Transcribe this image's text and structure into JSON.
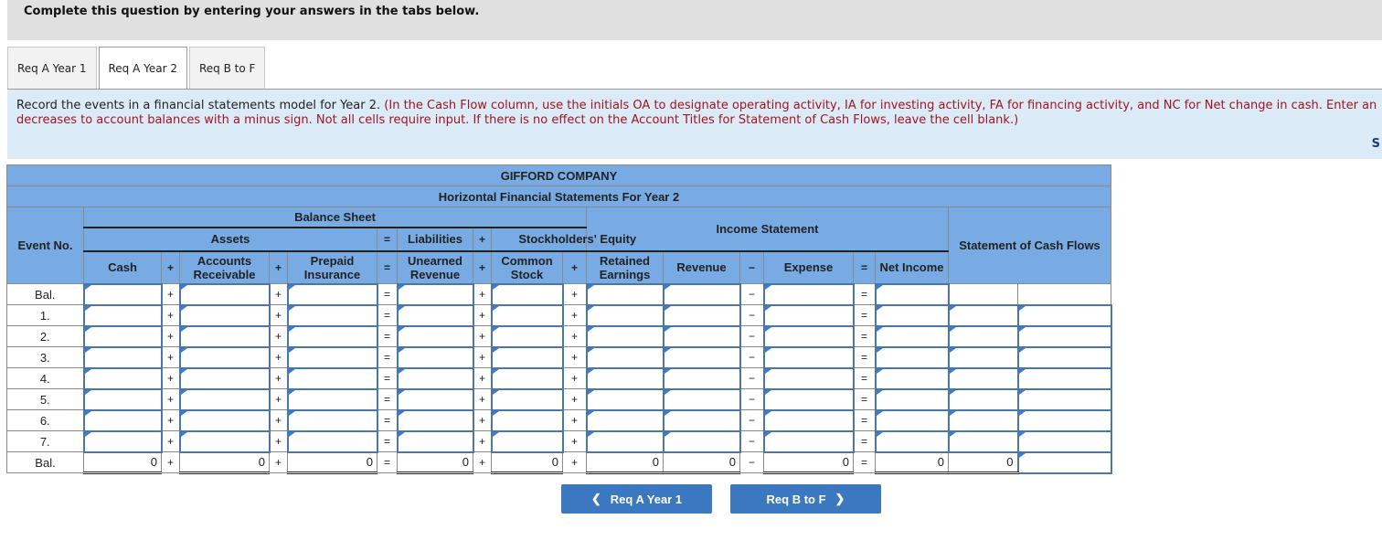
{
  "banner": "Complete this question by entering your answers in the tabs below.",
  "tabs": [
    {
      "label": "Req A Year 1",
      "active": false
    },
    {
      "label": "Req A Year 2",
      "active": true
    },
    {
      "label": "Req B to F",
      "active": false
    }
  ],
  "instructions": {
    "main": "Record the events in a financial statements model for Year 2.",
    "note_line1": "(In the Cash Flow column, use the initials OA to designate operating activity, IA for investing activity, FA for financing activity, and NC for Net change in cash. Enter an",
    "note_line2": "decreases to account balances with a minus sign. Not all cells require input. If there is no effect on the Account Titles for Statement of Cash Flows, leave the cell blank.)",
    "cut_letter": "S"
  },
  "table": {
    "company": "GIFFORD COMPANY",
    "subtitle": "Horizontal Financial Statements For Year 2",
    "event_header": "Event No.",
    "balance_sheet": "Balance Sheet",
    "income_statement": "Income Statement",
    "cash_flows": "Statement of Cash Flows",
    "assets": "Assets",
    "liabilities": "Liabilities",
    "equity": "Stockholders' Equity",
    "cols": {
      "cash": "Cash",
      "ar_1": "Accounts",
      "ar_2": "Receivable",
      "pi_1": "Prepaid",
      "pi_2": "Insurance",
      "ur_1": "Unearned",
      "ur_2": "Revenue",
      "cs_1": "Common",
      "cs_2": "Stock",
      "re_1": "Retained",
      "re_2": "Earnings",
      "revenue": "Revenue",
      "expense": "Expense",
      "net_income": "Net Income"
    },
    "ops": {
      "plus": "+",
      "equals": "=",
      "minus": "−"
    },
    "rows": [
      "Bal.",
      "1.",
      "2.",
      "3.",
      "4.",
      "5.",
      "6.",
      "7."
    ],
    "totals": {
      "label": "Bal.",
      "cash": "0",
      "ar": "0",
      "pi": "0",
      "ur": "0",
      "cs": "0",
      "re": "0",
      "revenue": "0",
      "expense": "0",
      "net_income": "0",
      "cash_flow_amount": "0"
    }
  },
  "buttons": {
    "prev": "Req A Year 1",
    "next": "Req B to F"
  }
}
